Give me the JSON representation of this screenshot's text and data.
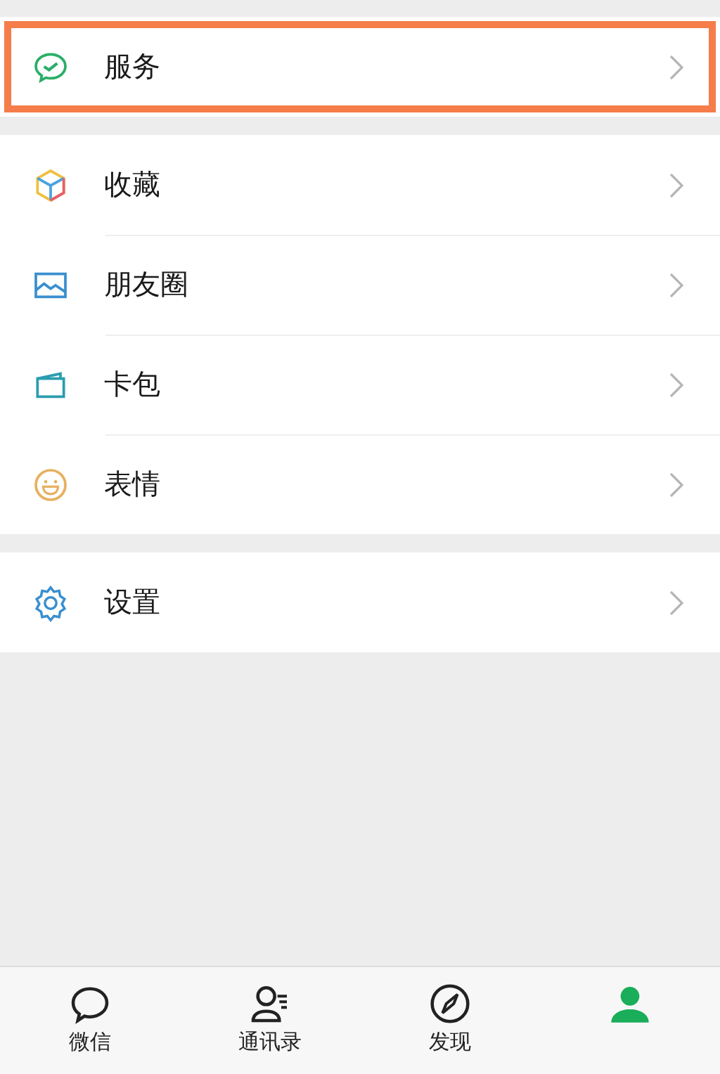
{
  "groups": [
    {
      "items": [
        {
          "label": "服务",
          "highlighted": true
        }
      ]
    },
    {
      "items": [
        {
          "label": "收藏",
          "highlighted": false
        },
        {
          "label": "朋友圈",
          "highlighted": false
        },
        {
          "label": "卡包",
          "highlighted": false
        },
        {
          "label": "表情",
          "highlighted": false
        }
      ]
    },
    {
      "items": [
        {
          "label": "设置",
          "highlighted": false
        }
      ]
    }
  ],
  "tab_bar": [
    {
      "label": "微信",
      "selected": false
    },
    {
      "label": "通讯录",
      "selected": false
    },
    {
      "label": "发现",
      "selected": false
    },
    {
      "selected": true
    }
  ]
}
